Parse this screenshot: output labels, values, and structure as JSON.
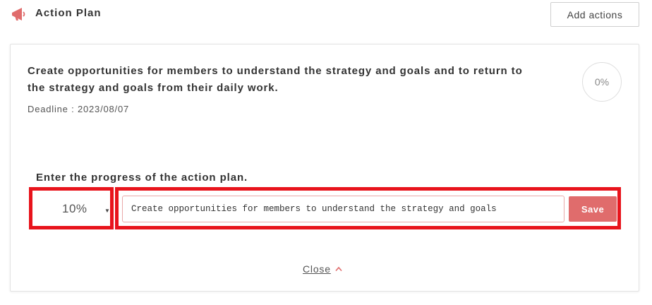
{
  "header": {
    "title": "Action Plan",
    "icon": "megaphone-icon",
    "add_button_label": "Add actions"
  },
  "plan": {
    "title": "Create opportunities for members to understand the strategy and goals and to return to the strategy and goals from their daily work.",
    "deadline": "Deadline : 2023/08/07",
    "current_progress": "0%"
  },
  "progress_form": {
    "label": "Enter the progress of the action plan.",
    "selected_percent": "10%",
    "comment_value": "Create opportunities for members to understand the strategy and goals",
    "save_label": "Save"
  },
  "footer": {
    "close_label": "Close",
    "close_icon": "chevron-up-icon"
  },
  "colors": {
    "accent": "#e06c6c",
    "highlight_border": "#e8141c"
  }
}
